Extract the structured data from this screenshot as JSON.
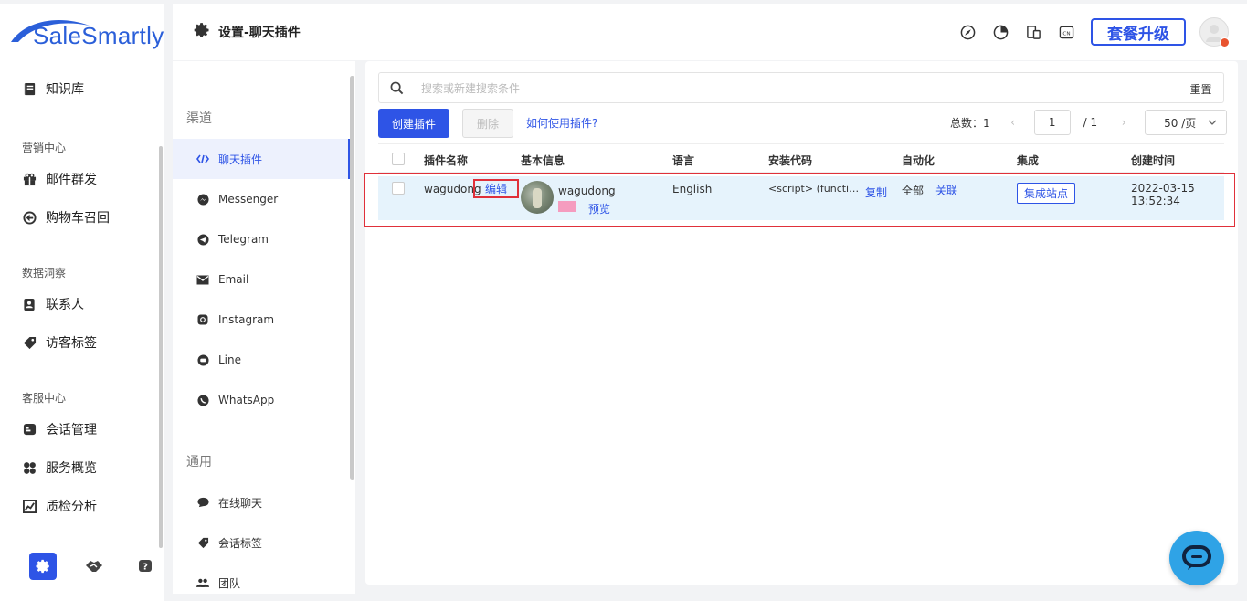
{
  "brand": {
    "name": "SaleSmartly"
  },
  "left_nav": {
    "items": [
      {
        "label": "知识库",
        "icon": "book-icon"
      },
      {
        "section": "营销中心"
      },
      {
        "label": "邮件群发",
        "icon": "gift-icon"
      },
      {
        "label": "购物车召回",
        "icon": "cart-recall-icon"
      },
      {
        "section": "数据洞察"
      },
      {
        "label": "联系人",
        "icon": "contact-icon"
      },
      {
        "label": "访客标签",
        "icon": "tag-icon"
      },
      {
        "section": "客服中心"
      },
      {
        "label": "会话管理",
        "icon": "chat-manage-icon"
      },
      {
        "label": "服务概览",
        "icon": "grid-icon"
      },
      {
        "label": "质检分析",
        "icon": "chart-icon"
      }
    ]
  },
  "top_bar": {
    "title": "设置-聊天插件",
    "upgrade_label": "套餐升级",
    "lang_badge": "CN"
  },
  "settings_nav": {
    "channel_section": "渠道",
    "channels": [
      "聊天插件",
      "Messenger",
      "Telegram",
      "Email",
      "Instagram",
      "Line",
      "WhatsApp"
    ],
    "general_section": "通用",
    "general": [
      "在线聊天",
      "会话标签",
      "团队"
    ]
  },
  "search": {
    "placeholder": "搜索或新建搜索条件",
    "reset_label": "重置"
  },
  "toolbar": {
    "create_label": "创建插件",
    "delete_label": "删除",
    "help_link": "如何使用插件?"
  },
  "pager": {
    "total_label": "总数：1",
    "current_page": "1",
    "of_pages": "/  1",
    "page_size": "50 /页"
  },
  "table": {
    "headers": [
      "插件名称",
      "基本信息",
      "语言",
      "安装代码",
      "自动化",
      "集成",
      "创建时间"
    ],
    "row": {
      "plugin_name": "wagudong",
      "edit_label": "编辑",
      "info_name": "wagudong",
      "preview_label": "预览",
      "swatch_color": "#f59cbf",
      "language": "English",
      "install_code": "<script> (functi…",
      "copy_label": "复制",
      "automation": "全部",
      "link_label": "关联",
      "integrate_label": "集成站点",
      "created_date": "2022-03-15",
      "created_time": "13:52:34"
    }
  },
  "colors": {
    "accent": "#2e54e6",
    "highlight_border": "#e0303a",
    "row_bg": "#e6f3fc",
    "fab": "#2fa3e6"
  }
}
